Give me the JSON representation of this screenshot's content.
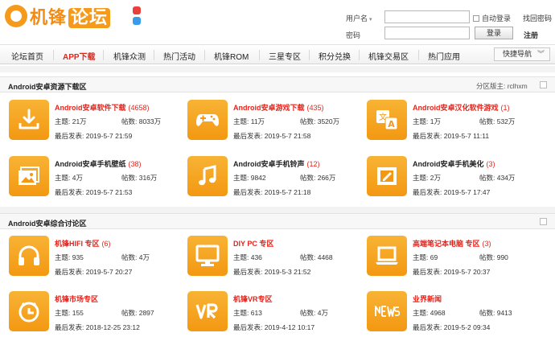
{
  "header": {
    "logo_main": "机锋",
    "logo_alt": "论坛",
    "social": [
      "weibo-icon",
      "qq-icon"
    ],
    "login": {
      "username_label": "用户名",
      "password_label": "密码",
      "autologin_label": "自动登录",
      "forgot_label": "找回密码",
      "login_button": "登录",
      "register_label": "注册"
    }
  },
  "nav": {
    "items": [
      "论坛首页",
      "APP下载",
      "机锋众测",
      "热门活动",
      "机锋ROM",
      "三星专区",
      "积分兑换",
      "机锋交易区",
      "热门应用"
    ],
    "active_index": 1,
    "quick_nav": "快捷导航"
  },
  "sections": [
    {
      "title": "Android安卓资源下载区",
      "moderators": "分区版主: rclhxm",
      "forums": [
        {
          "name": "Android安卓软件下载",
          "count": "(4658)",
          "topics": "主题: 21万",
          "posts": "帖数: 8033万",
          "last": "最后发表: 2019-5-7 21:59",
          "icon": "download-icon",
          "name_color": "red"
        },
        {
          "name": "Android安卓游戏下载",
          "count": "(435)",
          "topics": "主题: 11万",
          "posts": "帖数: 3520万",
          "last": "最后发表: 2019-5-7 21:58",
          "icon": "gamepad-icon",
          "name_color": "red"
        },
        {
          "name": "Android安卓汉化软件游戏",
          "count": "(1)",
          "topics": "主题: 1万",
          "posts": "帖数: 532万",
          "last": "最后发表: 2019-5-7 11:11",
          "icon": "translate-icon",
          "name_color": "red"
        },
        {
          "name": "Android安卓手机壁纸",
          "count": "(38)",
          "topics": "主题: 4万",
          "posts": "帖数: 316万",
          "last": "最后发表: 2019-5-7 21:53",
          "icon": "wallpaper-icon",
          "name_color": "dark"
        },
        {
          "name": "Android安卓手机铃声",
          "count": "(12)",
          "topics": "主题: 9842",
          "posts": "帖数: 266万",
          "last": "最后发表: 2019-5-7 21:18",
          "icon": "music-note-icon",
          "name_color": "dark"
        },
        {
          "name": "Android安卓手机美化",
          "count": "(3)",
          "topics": "主题: 2万",
          "posts": "帖数: 434万",
          "last": "最后发表: 2019-5-7 17:47",
          "icon": "picture-frame-icon",
          "name_color": "dark"
        }
      ]
    },
    {
      "title": "Android安卓综合讨论区",
      "moderators": "",
      "forums": [
        {
          "name": "机锋HIFI 专区",
          "count": "(6)",
          "topics": "主题: 935",
          "posts": "帖数: 4万",
          "last": "最后发表: 2019-5-7 20:27",
          "icon": "headphones-icon",
          "name_color": "red"
        },
        {
          "name": "DIY PC 专区",
          "count": "",
          "topics": "主题: 436",
          "posts": "帖数: 4468",
          "last": "最后发表: 2019-5-3 21:52",
          "icon": "monitor-icon",
          "name_color": "red"
        },
        {
          "name": "高端笔记本电脑 专区",
          "count": "(3)",
          "topics": "主题: 69",
          "posts": "帖数: 990",
          "last": "最后发表: 2019-5-7 20:37",
          "icon": "laptop-icon",
          "name_color": "red"
        },
        {
          "name": "机锋市场专区",
          "count": "",
          "topics": "主题: 155",
          "posts": "帖数: 2897",
          "last": "最后发表: 2018-12-25 23:12",
          "icon": "market-logo-icon",
          "name_color": "red"
        },
        {
          "name": "机锋VR专区",
          "count": "",
          "topics": "主题: 613",
          "posts": "帖数: 4万",
          "last": "最后发表: 2019-4-12 10:17",
          "icon": "vr-icon",
          "name_color": "red"
        },
        {
          "name": "业界新闻",
          "count": "",
          "topics": "主题: 4968",
          "posts": "帖数: 9413",
          "last": "最后发表: 2019-5-2 09:34",
          "icon": "news-icon",
          "name_color": "red"
        }
      ]
    }
  ],
  "colors": {
    "accent_orange": "#f39812",
    "link_red": "#e5241c",
    "nav_bg": "#f1f1f1"
  }
}
